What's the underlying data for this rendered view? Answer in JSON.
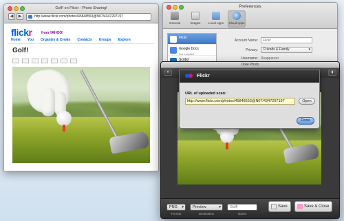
{
  "browser": {
    "title": "Golf! on Flickr - Photo Sharing!",
    "url": "http://www.flickr.com/photos/45848553@N07/4347297197",
    "logo_a": "flick",
    "logo_b": "r",
    "from_yahoo": "from YAHOO!",
    "nav": [
      "Home",
      "You",
      "Organize & Create",
      "Contacts",
      "Groups",
      "Explore"
    ],
    "photo_title": "Golf!"
  },
  "prefs": {
    "title": "Preferences",
    "tabs": [
      "General",
      "Images",
      "Local Apps",
      "Cloud Apps"
    ],
    "services": [
      {
        "name": "Flickr",
        "sub": ""
      },
      {
        "name": "Google Docs",
        "sub": "Not installed"
      },
      {
        "name": "Scribd",
        "sub": ""
      }
    ],
    "account_name_label": "Account Name:",
    "account_name_placeholder": "Flickr",
    "privacy_label": "Privacy:",
    "privacy_value": "Friends & Family",
    "username_label": "Username:",
    "username_value": "Rsappareet"
  },
  "dixie": {
    "title": "Dixie Photo",
    "format_value": "PNG",
    "format_label": "Format",
    "destination_value": "Preview",
    "destination_label": "Destination",
    "name_value": "Golf!",
    "name_label": "Name",
    "save_label": "Save",
    "save_close_label": "Save & Close"
  },
  "sheet": {
    "title": "Flickr",
    "url_label": "URL of uploaded scan:",
    "url_value": "http://www.flickr.com/photos/45848553@N07/4347297197",
    "open_label": "Open",
    "done_label": "Done"
  }
}
